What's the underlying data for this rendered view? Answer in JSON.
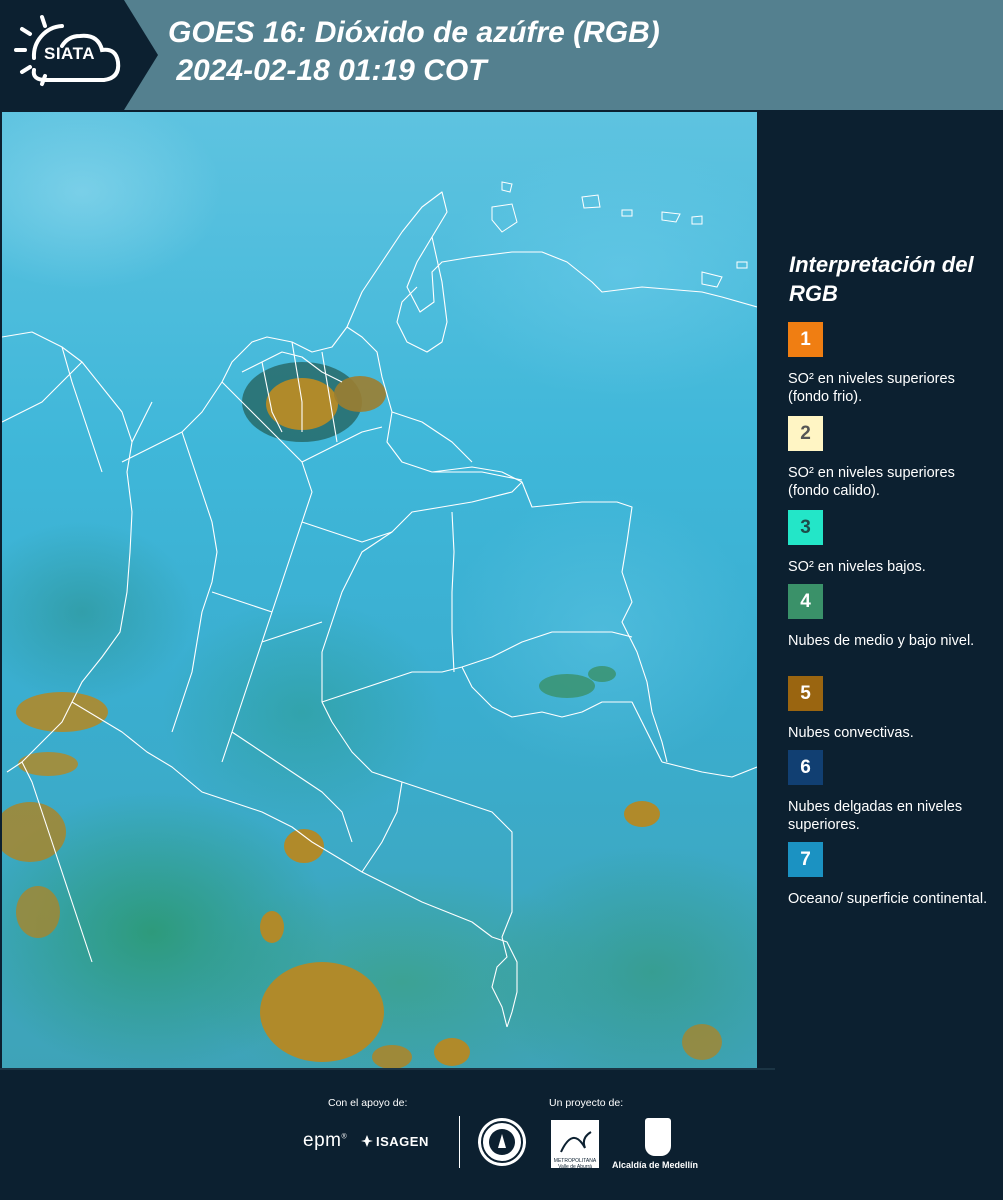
{
  "header": {
    "logo_text": "SIATA",
    "title_line1": "GOES 16: Dióxido de azúfre (RGB)",
    "title_line2": " 2024-02-18 01:19 COT"
  },
  "legend": {
    "title": "Interpretación del RGB",
    "items": [
      {
        "number": "1",
        "color": "#f07e12",
        "text_color": "#ffffff",
        "label": "SO² en niveles superiores (fondo frio)."
      },
      {
        "number": "2",
        "color": "#fff5c4",
        "text_color": "#555555",
        "label": "SO² en niveles superiores (fondo calido)."
      },
      {
        "number": "3",
        "color": "#23e6c8",
        "text_color": "#1d4d4a",
        "label": "SO² en niveles bajos."
      },
      {
        "number": "4",
        "color": "#3a9169",
        "text_color": "#ffffff",
        "label": "Nubes de medio y bajo nivel."
      },
      {
        "number": "5",
        "color": "#9a6510",
        "text_color": "#ffffff",
        "label": "Nubes convectivas."
      },
      {
        "number": "6",
        "color": "#113f72",
        "text_color": "#ffffff",
        "label": "Nubes delgadas en niveles superiores."
      },
      {
        "number": "7",
        "color": "#1b92c2",
        "text_color": "#ffffff",
        "label": "Oceano/ superficie continental."
      }
    ]
  },
  "footer": {
    "support_label": "Con el apoyo de:",
    "project_label": "Un proyecto de:",
    "epm": "epm",
    "isagen": "ISAGEN",
    "amva": "METROPOLITANA Valle de Aburrá",
    "alcaldia": "Alcaldía de Medellín"
  },
  "map_colors": {
    "convective": "#b08a2a",
    "convective_dark": "#1d4a3a",
    "border": "#ffffff"
  }
}
